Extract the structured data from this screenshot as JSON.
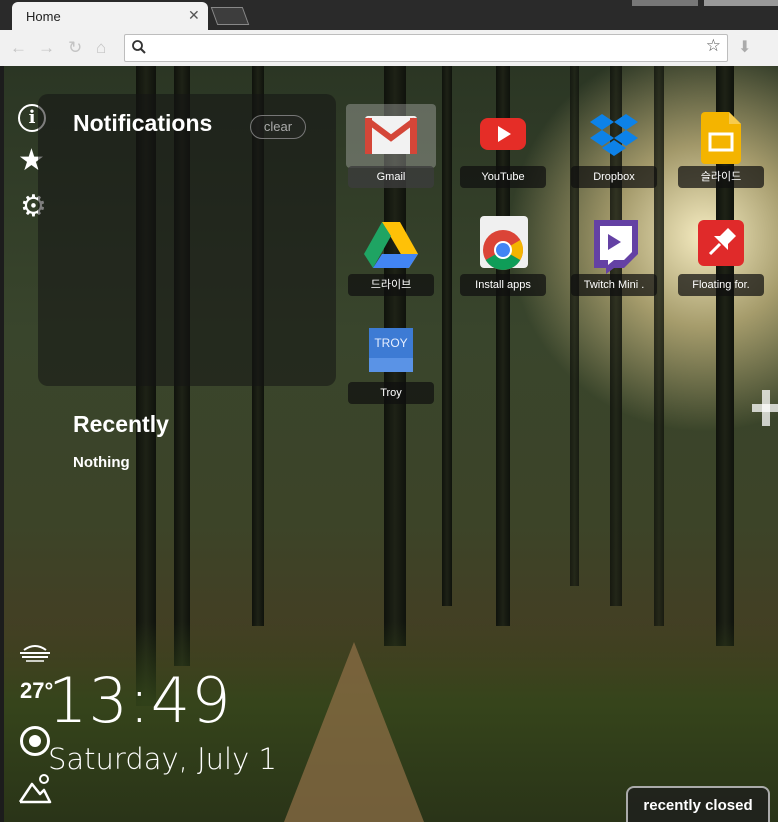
{
  "tab": {
    "title": "Home",
    "close": "✕"
  },
  "toolbar": {
    "url_value": "",
    "url_placeholder": ""
  },
  "sidebar": {
    "info_glyph": "i",
    "star_glyph": "★",
    "gear_glyph": "⚙"
  },
  "notifications": {
    "title": "Notifications",
    "clear_label": "clear"
  },
  "recently": {
    "title": "Recently",
    "empty_text": "Nothing"
  },
  "apps": [
    {
      "label": "Gmail",
      "icon": "gmail-icon"
    },
    {
      "label": "YouTube",
      "icon": "youtube-icon"
    },
    {
      "label": "Dropbox",
      "icon": "dropbox-icon"
    },
    {
      "label": "슬라이드",
      "icon": "slides-icon"
    },
    {
      "label": "드라이브",
      "icon": "drive-icon"
    },
    {
      "label": "Install apps",
      "icon": "chrome-webstore-icon"
    },
    {
      "label": "Twitch Mini .",
      "icon": "twitch-icon"
    },
    {
      "label": "Floating for.",
      "icon": "pin-icon"
    },
    {
      "label": "Troy",
      "icon": "troy-icon",
      "icon_text": "TROY"
    }
  ],
  "widget": {
    "temperature": "27°",
    "time": "13:49",
    "date": "Saturday, July 1"
  },
  "footer": {
    "recently_closed_label": "recently closed"
  },
  "colors": {
    "gmail_red": "#d44638",
    "youtube_red": "#e52d27",
    "dropbox_blue": "#0d82e8",
    "slides_yellow": "#f4b400",
    "twitch_purple": "#6441a4",
    "pin_red": "#e02a2a",
    "troy_blue": "#3d7bd4"
  }
}
